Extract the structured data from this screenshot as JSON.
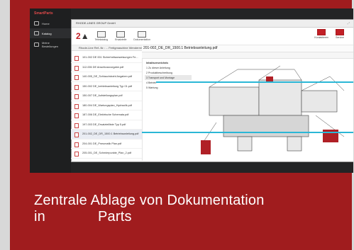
{
  "sidebar": {
    "brand": "SmartParts",
    "items": [
      {
        "label": "Home"
      },
      {
        "label": "Katalog"
      },
      {
        "label": "Meine Bestellungen"
      }
    ]
  },
  "window": {
    "title": "RHODE-LINES GROUP GmbH",
    "toolbar": {
      "logo": "2",
      "items": [
        {
          "label": "Teilekatalog"
        },
        {
          "label": "Ersatzteile"
        },
        {
          "label": "Dokumentation"
        }
      ],
      "right_items": [
        {
          "label": "Kontaktieren"
        },
        {
          "label": "Service"
        }
      ]
    },
    "banner": "Rhode-Line Ref.-Nr.: ... Fertigmaschine Wendermin, 5000 ...",
    "viewer_path": "201-002_DE_DR_1500.1 Betriebsanleitung.pdf",
    "files": [
      "101-002 DE 001 Sicherheitsanweisungen Fe...",
      "112-006 DE Anschlussvorgabe.pdf",
      "140-005_DE_Schlauchdraht Angaben.pdf",
      "150-002 DE_betriebsanleitung Typ 01.pdf",
      "150-007 DE_Aufstellungsplan.pdf",
      "180-004 DE_Wartungsplan_Hydraulik.pdf",
      "187-006 DE_Elektrische Schemata.pdf",
      "197-003 DE_Ersatzteilliste Typ 5.pdf",
      "201-002_DE_DR_1500.1 Betriebsanleitung.pdf",
      "204-001 DE_Pneumatik Plan.pdf",
      "205-001_DE_Schmierpunkte_Plan_2.pdf"
    ],
    "outline": {
      "heading": "Inhaltsverzeichnis",
      "items": [
        "1 Zu dieser Anleitung",
        "2 Produktbeschreibung",
        "3 Transport und Montage",
        "4 Betrieb",
        "5 Wartung"
      ]
    }
  },
  "caption": {
    "line1": "Zentrale Ablage von Dokumentation",
    "line2_word1": "in",
    "line2_word2": "Parts"
  }
}
